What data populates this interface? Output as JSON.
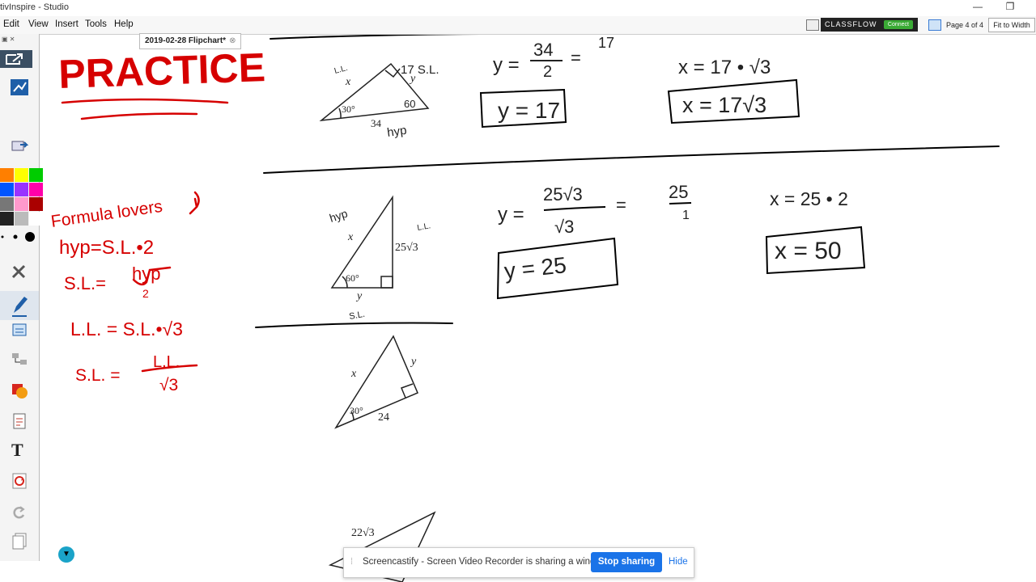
{
  "window": {
    "title": "tivInspire - Studio",
    "min_glyph": "—",
    "restore_glyph": "❐"
  },
  "menu": {
    "edit": "Edit",
    "view": "View",
    "insert": "Insert",
    "tools": "Tools",
    "help": "Help"
  },
  "tab": {
    "label": "2019-02-28 Flipchart*",
    "close": "⊗"
  },
  "toolbar": {
    "classflow": "CLASSFLOW",
    "connect": "Connect",
    "page_info": "Page 4 of 4",
    "fit": "Fit to Width"
  },
  "palette": [
    "#ff7f00",
    "#ffff00",
    "#00cc00",
    "#0055ff",
    "#9933ff",
    "#ff00aa",
    "#777777",
    "#ff99cc",
    "#aa0000",
    "#222222",
    "#bbbbbb",
    "#ffffff"
  ],
  "colors": {
    "ink": "#d60000",
    "pen": "#000000"
  },
  "flipchart": {
    "practice_title": "PRACTICE",
    "formula_heading": "Formula lovers",
    "formula_hyp": "hyp=S.L.•2",
    "formula_sl": "S.L.=",
    "formula_sl_num": "hyp",
    "formula_sl_den": "2",
    "formula_ll": "L.L. = S.L.•√3",
    "formula_sl2": "S.L. =",
    "formula_sl2_num": "L.L.",
    "formula_sl2_den": "√3",
    "p1": {
      "x": "x",
      "y": "y",
      "angle": "30°",
      "hyp_val": "34",
      "ll": "L.L.",
      "sl": "17 S.L.",
      "hyp": "hyp",
      "sixty": "60",
      "y_lhs": "y =",
      "y_num": "34",
      "y_den": "2",
      "y_eq": "=",
      "y_res": "17",
      "y_box": "y = 17",
      "x_eq": "x = 17 • √3",
      "x_box": "x = 17√3"
    },
    "p2": {
      "hyp": "hyp",
      "x": "x",
      "ll_val": "25√3",
      "ll": "L.L.",
      "angle": "60°",
      "y": "y",
      "sl": "S.L.",
      "y_lhs": "y =",
      "y_num": "25√3",
      "y_den": "√3",
      "y_eq": "=",
      "y_r_num": "25",
      "y_r_den": "1",
      "y_box": "y = 25",
      "x_eq": "x = 25 • 2",
      "x_box": "x = 50"
    },
    "p3": {
      "x": "x",
      "y": "y",
      "angle": "30°",
      "side": "24"
    },
    "p4": {
      "side": "22√3"
    }
  },
  "share": {
    "message": "Screencastify - Screen Video Recorder is sharing a window.",
    "stop": "Stop sharing",
    "hide": "Hide"
  }
}
